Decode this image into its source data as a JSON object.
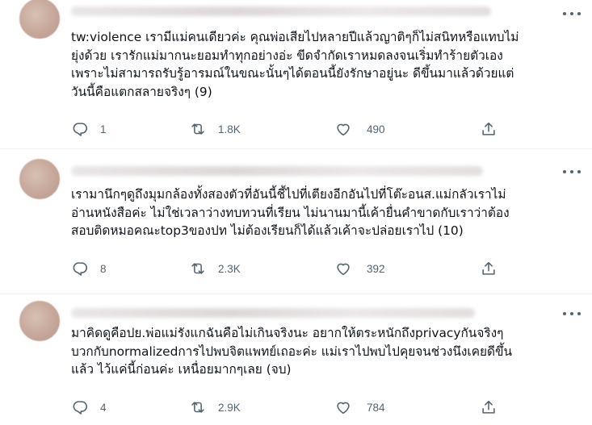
{
  "tweets": [
    {
      "lines": [
        "tw:violence เรามีแม่คนเดียวค่ะ คุณพ่อเสียไปหลายปีแล้วญาติๆก็ไม่สนิทหรือแทบไม่",
        "ยุ่งด้วย เรารักแม่มากนะยอมทำทุกอย่างอ่ะ ขีดจำกัดเราหมดลงจนเริ่มทำร้ายตัวเอง",
        "เพราะไม่สามารถรับรู้อารมณ์ในขณะนั้นๆได้ตอนนี้ยังรักษาอยู่นะ ดีขึ้นมาแล้วด้วยแต่",
        "วันนี้คือแตกสลายจริงๆ (9)"
      ],
      "replies": "1",
      "retweets": "1.8K",
      "likes": "490"
    },
    {
      "lines": [
        "เรามานึกๆดูถึงมุมกล้องทั้งสองตัวที่อันนี้ชี้ไปที่เตียงอีกอันไปที่โต๊ะอนส.แม่กลัวเราไม่",
        "อ่านหนังสือค่ะ ไม่ใช่เวลาว่างทบทวนที่เรียน ไม่นานมานี้เค้ายื่นคำขาดกับเราว่าต้อง",
        "สอบติดหมอคณะtop3ของปท ไม่ต้องเรียนก็ได้แล้วเค้าจะปล่อยเราไป (10)"
      ],
      "replies": "8",
      "retweets": "2.3K",
      "likes": "392"
    },
    {
      "lines": [
        "มาคิดดูคือปย.พ่อแม่รังแกฉันคือไม่เกินจริงนะ อยากให้ตระหนักถึงprivacyกันจริงๆ",
        "บวกกับnormalizedการไปพบจิตแพทย์เถอะค่ะ แม่เราไปพบไปคุยจนช่วงนึงเคยดีขึ้น",
        "แล้ว ไว้แค่นี้ก่อนค่ะ เหนื่อยมากๆเลย (จบ)"
      ],
      "replies": "4",
      "retweets": "2.9K",
      "likes": "784"
    }
  ],
  "icons": {
    "reply": "reply-icon",
    "retweet": "retweet-icon",
    "like": "heart-icon",
    "share": "share-icon",
    "more": "more-icon"
  },
  "colors": {
    "text": "#0f1419",
    "secondary": "#536471",
    "divider": "#eff3f4"
  }
}
